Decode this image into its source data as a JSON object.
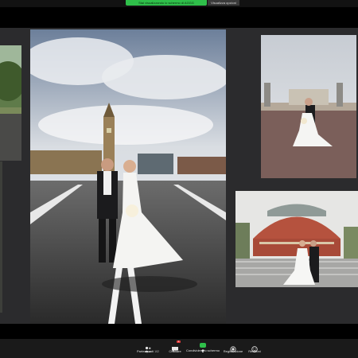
{
  "banner": {
    "sharing_text": "Stai visualizzando lo schermo di AGGG",
    "view_options": "Visualizza opzioni"
  },
  "controls": {
    "participants_label": "Partecipanti",
    "participants_count": "102",
    "chat_label": "Chattare",
    "chat_badge": "1",
    "share_label": "Condividere lo schermo",
    "record_label": "Registrazione",
    "reactions_label": "Reazioni"
  },
  "colors": {
    "share_green": "#2fbf4a",
    "stage_gray": "#2b2b2d",
    "toolbar_bg": "#1a1a1a"
  },
  "icons": [
    "participants-icon",
    "chat-icon",
    "share-screen-icon",
    "record-icon",
    "reactions-icon",
    "chevron-up-icon"
  ]
}
